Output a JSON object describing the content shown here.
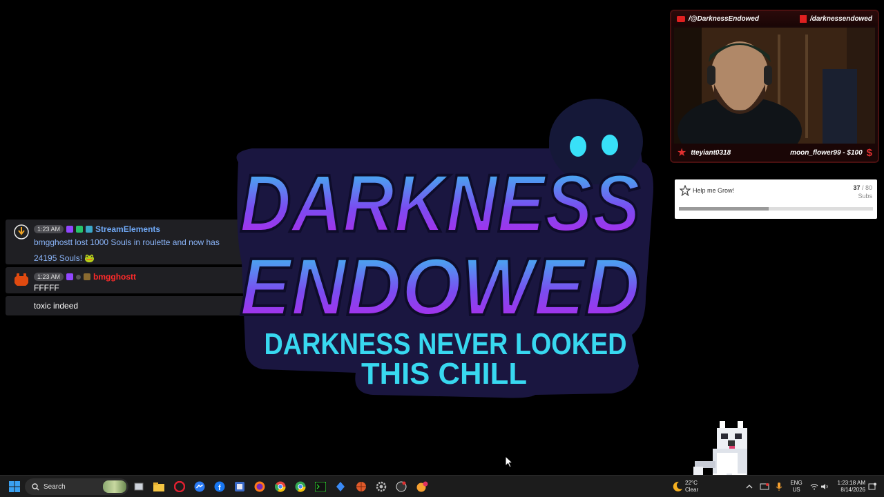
{
  "chat": {
    "messages": [
      {
        "time": "1:23 AM",
        "username": "StreamElements",
        "username_color": "#6fa8f5",
        "text": "bmgghostt lost 1000 Souls in roulette and now has 24195 Souls! 🐸"
      },
      {
        "time": "1:23 AM",
        "username": "bmgghostt",
        "username_color": "#ff2a2a",
        "text": "FFFFF"
      },
      {
        "time": "",
        "username": "",
        "text": "toxic indeed"
      }
    ]
  },
  "logo": {
    "line1": "DARKNESS",
    "line2": "ENDOWED",
    "tagline1": "DARKNESS NEVER LOOKED",
    "tagline2": "THIS CHILL"
  },
  "webcam": {
    "youtube_handle": "/@DarknessEndowed",
    "twitch_handle": "/darknessendowed",
    "recent_follower": "tteyiant0318",
    "recent_tip": "moon_flower99 - $100"
  },
  "goal": {
    "title": "Help me Grow!",
    "current": "37",
    "target": "/ 80",
    "unit": "Subs",
    "progress": 0.4625
  },
  "taskbar": {
    "search_label": "Search",
    "weather_temp": "22°C",
    "weather_desc": "Clear",
    "lang": "ENG",
    "region": "US",
    "time": "1:23:18 AM",
    "date": "8/14/2026"
  },
  "colors": {
    "logo_cyan": "#38d8f0",
    "logo_purple": "#a020f0",
    "logo_outline": "#1a1640",
    "accent_red": "#e03030"
  }
}
